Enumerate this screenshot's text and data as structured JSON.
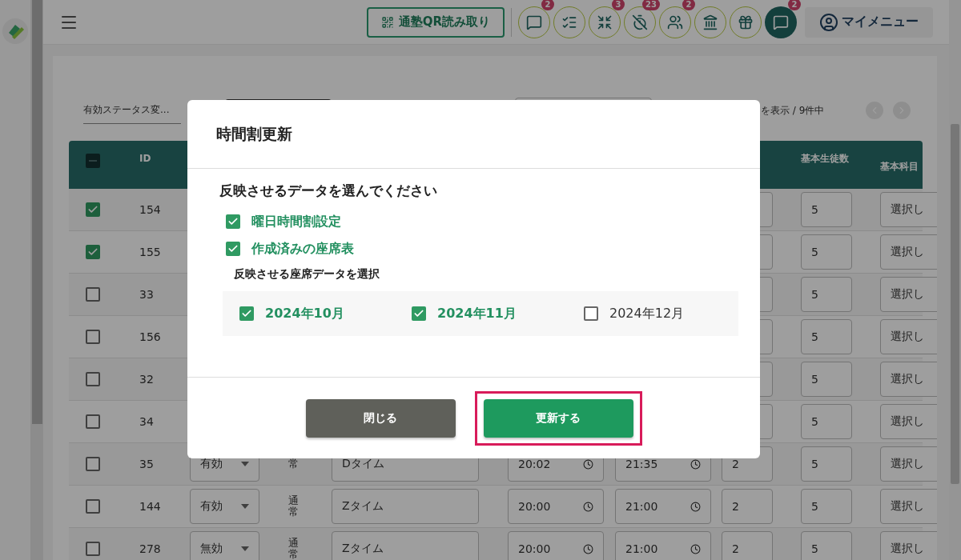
{
  "header": {
    "qr_button": "通塾QR読み取り",
    "icon_buttons": [
      {
        "kind": "chat",
        "badge": "2",
        "active": false
      },
      {
        "kind": "checklist",
        "active": false
      },
      {
        "kind": "arrows",
        "badge": "3",
        "active": false
      },
      {
        "kind": "clock_off",
        "badge": "23",
        "active": false
      },
      {
        "kind": "people",
        "badge": "2",
        "active": false
      },
      {
        "kind": "bank",
        "active": false
      },
      {
        "kind": "gift",
        "active": false
      },
      {
        "kind": "chat",
        "badge": "2",
        "active": true
      }
    ],
    "my_menu": "マイメニュー"
  },
  "toolbar": {
    "status_filter": "有効ステータス変...",
    "page_info": "を表示 / 9件中"
  },
  "table": {
    "select_all": {
      "indeterminate": true
    },
    "columns": [
      "ID",
      "基本生徒数",
      "基本科目"
    ],
    "rows": [
      {
        "checked": true,
        "id": "154",
        "students": "5",
        "subject": "選択し"
      },
      {
        "checked": true,
        "id": "155",
        "students": "5",
        "subject": "選択し"
      },
      {
        "checked": false,
        "id": "33",
        "students": "5",
        "subject": "選択し"
      },
      {
        "checked": false,
        "id": "156",
        "students": "5",
        "subject": "選択し"
      },
      {
        "checked": false,
        "id": "32",
        "students": "5",
        "subject": "選択し"
      },
      {
        "checked": false,
        "id": "34",
        "students": "5",
        "subject": "選択し"
      },
      {
        "checked": false,
        "id": "35",
        "status": "有効",
        "type": "常",
        "name": "Dタイム",
        "start": "20:02",
        "end": "21:35",
        "count": "2",
        "students": "5",
        "subject": "選択し"
      },
      {
        "checked": false,
        "id": "144",
        "status": "有効",
        "type": "通常",
        "name": "Zタイム",
        "start": "20:00",
        "end": "21:00",
        "count": "2",
        "students": "5",
        "subject": "選択し"
      },
      {
        "checked": false,
        "id": "278",
        "status": "無効",
        "type": "通常",
        "name": "Zタイム",
        "start": "20:00",
        "end": "21:00",
        "count": "2",
        "students": "5",
        "subject": "選択し"
      }
    ]
  },
  "dialog": {
    "title": "時間割更新",
    "prompt": "反映させるデータを選んでください",
    "options": [
      {
        "label": "曜日時間割設定",
        "checked": true
      },
      {
        "label": "作成済みの座席表",
        "checked": true
      }
    ],
    "seat_prompt": "反映させる座席データを選択",
    "months": [
      {
        "label": "2024年10月",
        "checked": true
      },
      {
        "label": "2024年11月",
        "checked": true
      },
      {
        "label": "2024年12月",
        "checked": false
      }
    ],
    "buttons": [
      {
        "label": "閉じる",
        "kind": "secondary",
        "highlighted": false
      },
      {
        "label": "更新する",
        "kind": "primary",
        "highlighted": true
      }
    ]
  }
}
